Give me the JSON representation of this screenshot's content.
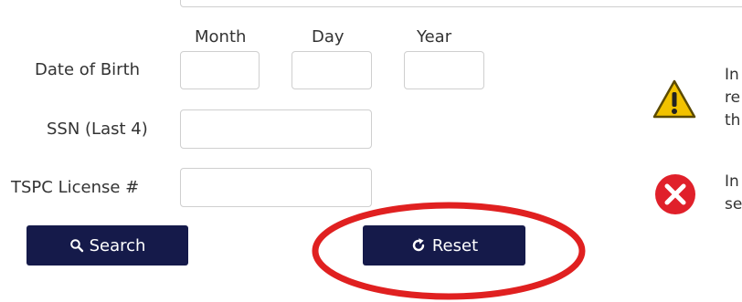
{
  "form": {
    "dob_columns": {
      "month": "Month",
      "day": "Day",
      "year": "Year"
    },
    "dob_label": "Date of Birth",
    "ssn_label": "SSN (Last 4)",
    "license_label": "TSPC License #",
    "month_value": "",
    "day_value": "",
    "year_value": "",
    "ssn_value": "",
    "license_value": ""
  },
  "buttons": {
    "search_label": "Search",
    "reset_label": "Reset"
  },
  "notices": {
    "warning_lines": [
      "In",
      "re",
      "th"
    ],
    "error_lines": [
      "In",
      "se"
    ]
  },
  "icons": {
    "search": "search-icon",
    "reset": "refresh-icon",
    "warning": "warning-icon",
    "error": "error-icon"
  },
  "colors": {
    "button_bg": "#151a4a",
    "annotation_red": "#e02020",
    "warning_yellow": "#f2c200",
    "error_red": "#e0202a"
  }
}
